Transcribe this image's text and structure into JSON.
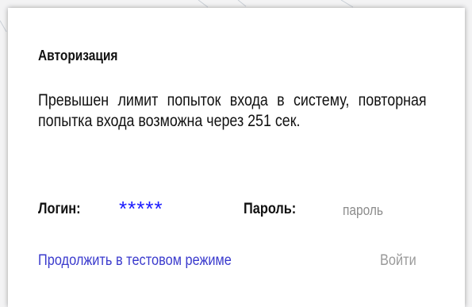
{
  "dialog": {
    "title": "Авторизация",
    "message": "Превышен лимит попыток входа в систему, повторная попытка входа возможна через 251 сек.",
    "login_label": "Логин:",
    "login_value": "*****",
    "password_label": "Пароль:",
    "password_placeholder": "пароль",
    "test_mode_link": "Продолжить в тестовом режиме",
    "login_button": "Войти"
  },
  "colors": {
    "link": "#3a3acd",
    "login_value": "#1a1aff",
    "disabled": "#9a9a9a",
    "placeholder": "#8c8c8c"
  }
}
